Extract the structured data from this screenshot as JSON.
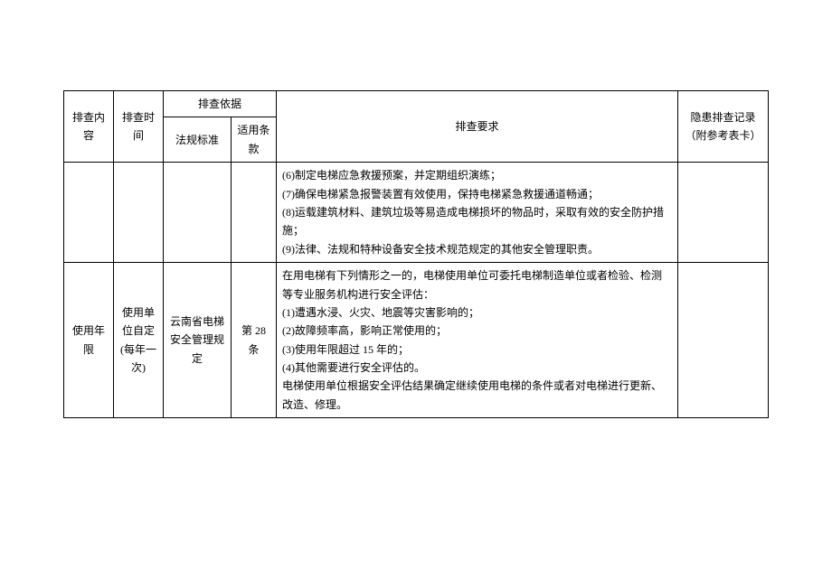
{
  "header": {
    "content": "排查内容",
    "time": "排查时间",
    "basis_group": "排查依据",
    "basis_std": "法规标准",
    "basis_clause": "适用条款",
    "requirement": "排查要求",
    "record": "隐患排查记录（附参考表卡）"
  },
  "rows": [
    {
      "content": "",
      "time": "",
      "std": "",
      "clause": "",
      "requirement": "(6)制定电梯应急救援预案，并定期组织演练；\n(7)确保电梯紧急报警装置有效使用，保持电梯紧急救援通道畅通；\n(8)运载建筑材料、建筑垃圾等易造成电梯损坏的物品时，采取有效的安全防护措施；\n(9)法律、法规和特种设备安全技术规范规定的其他安全管理职责。",
      "record": ""
    },
    {
      "content": "使用年限",
      "time": "使用单位自定(每年一次)",
      "std": "云南省电梯安全管理规定",
      "clause": "第 28 条",
      "requirement": "在用电梯有下列情形之一的，电梯使用单位可委托电梯制造单位或者检验、检测等专业服务机构进行安全评估：\n(1)遭遇水浸、火灾、地震等灾害影响的；\n(2)故障频率高，影响正常使用的；\n(3)使用年限超过 15 年的；\n(4)其他需要进行安全评估的。\n电梯使用单位根据安全评估结果确定继续使用电梯的条件或者对电梯进行更新、改造、修理。",
      "record": ""
    }
  ]
}
